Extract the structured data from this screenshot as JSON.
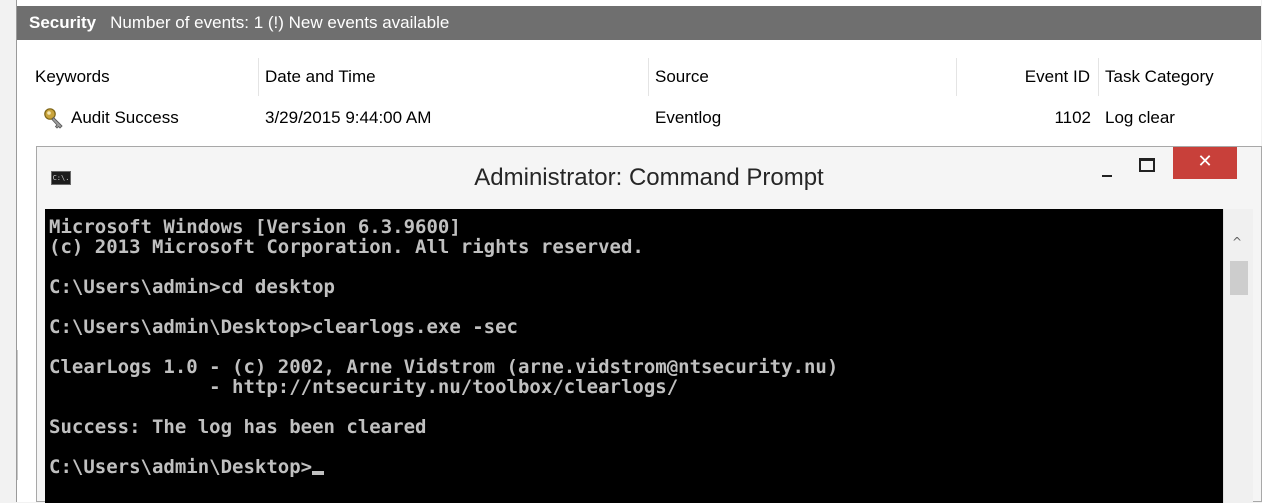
{
  "event_viewer": {
    "log_name": "Security",
    "summary": "Number of events: 1 (!) New events available",
    "columns": [
      "Keywords",
      "Date and Time",
      "Source",
      "Event ID",
      "Task Category"
    ],
    "events": [
      {
        "keywords": "Audit Success",
        "date_time": "3/29/2015 9:44:00 AM",
        "source": "Eventlog",
        "event_id": "1102",
        "task_category": "Log clear",
        "icon": "key-icon"
      }
    ],
    "colors": {
      "header_bg": "#6f6f6f",
      "header_text": "#ffffff"
    }
  },
  "cmd_window": {
    "title": "Administrator: Command Prompt",
    "icon": "cmd-icon",
    "icon_text": "C:\\.",
    "controls": {
      "minimize": "minimize-icon",
      "maximize": "maximize-icon",
      "close": "close-icon",
      "close_glyph": "✕"
    },
    "console_lines": [
      "Microsoft Windows [Version 6.3.9600]",
      "(c) 2013 Microsoft Corporation. All rights reserved.",
      "C:\\Users\\admin>cd desktop",
      "C:\\Users\\admin\\Desktop>clearlogs.exe -sec",
      "ClearLogs 1.0 - (c) 2002, Arne Vidstrom (arne.vidstrom@ntsecurity.nu)",
      "              - http://ntsecurity.nu/toolbox/clearlogs/",
      "Success: The log has been cleared",
      "C:\\Users\\admin\\Desktop>"
    ],
    "scroll_up_glyph": "^",
    "colors": {
      "console_bg": "#000000",
      "console_text": "#c0c0c0",
      "close_bg": "#c8403a"
    }
  }
}
